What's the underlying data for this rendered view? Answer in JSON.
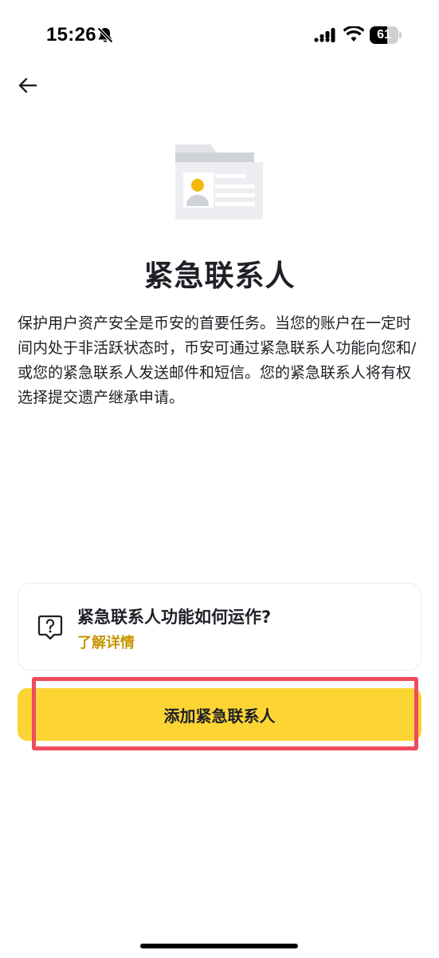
{
  "status_bar": {
    "time": "15:26",
    "battery": "61",
    "battery_level": 0.61,
    "icons": [
      "bell-off-icon",
      "cellular-signal-icon",
      "wifi-icon",
      "battery-icon"
    ]
  },
  "header": {
    "back_icon": "arrow-left-icon"
  },
  "illustration": {
    "icon": "id-card-folder-icon",
    "accent_color": "#f0b90b"
  },
  "title": "紧急联系人",
  "description": "保护用户资产安全是币安的首要任务。当您的账户在一定时间内处于非活跃状态时，币安可通过紧急联系人功能向您和/或您的紧急联系人发送邮件和短信。您的紧急联系人将有权选择提交遗产继承申请。",
  "info_card": {
    "icon": "question-bubble-icon",
    "title": "紧急联系人功能如何运作?",
    "link": "了解详情",
    "link_color": "#c99400"
  },
  "primary_button": {
    "label": "添加紧急联系人",
    "color": "#fcd535"
  },
  "annotation": {
    "color": "#ef4b5c"
  }
}
